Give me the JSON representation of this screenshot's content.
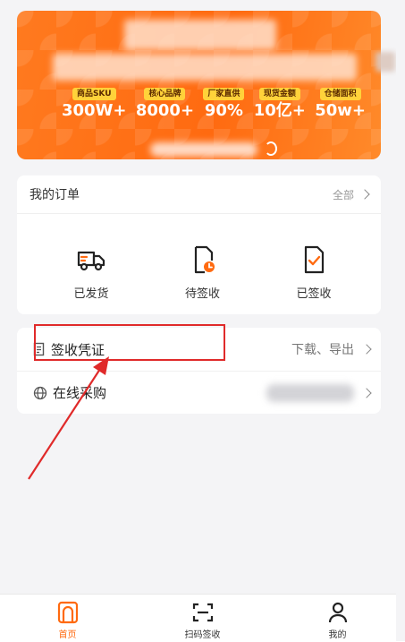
{
  "banner": {
    "stats": [
      {
        "label": "商品SKU",
        "value": "300W+"
      },
      {
        "label": "核心品牌",
        "value": "8000+"
      },
      {
        "label": "厂家直供",
        "value": "90%"
      },
      {
        "label": "现货金额",
        "value": "10亿+"
      },
      {
        "label": "仓储面积",
        "value": "50w+"
      }
    ]
  },
  "orders": {
    "title": "我的订单",
    "all_label": "全部",
    "items": [
      {
        "label": "已发货",
        "icon": "truck-icon"
      },
      {
        "label": "待签收",
        "icon": "pending-doc-icon"
      },
      {
        "label": "已签收",
        "icon": "signed-doc-icon"
      }
    ]
  },
  "links": [
    {
      "label": "签收凭证",
      "action": "下载、导出",
      "icon": "receipt-icon"
    },
    {
      "label": "在线采购",
      "icon": "globe-icon"
    }
  ],
  "tabs": [
    {
      "label": "首页",
      "icon": "home-icon",
      "active": true
    },
    {
      "label": "扫码签收",
      "icon": "scan-icon",
      "active": false
    },
    {
      "label": "我的",
      "icon": "user-icon",
      "active": false
    }
  ],
  "colors": {
    "accent": "#ff6a10",
    "annotation": "#e02a2a"
  }
}
